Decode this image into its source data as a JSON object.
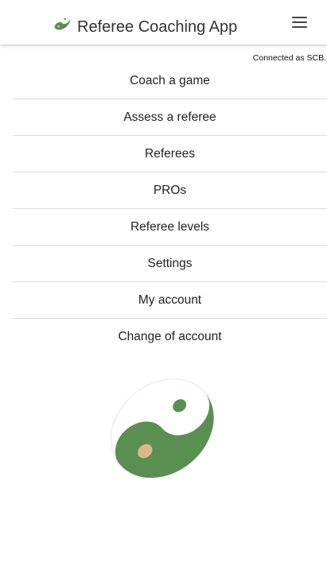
{
  "header": {
    "title": "Referee Coaching App",
    "logo_icon": "yin-yang-logo-icon",
    "menu_icon": "hamburger-menu-icon"
  },
  "status": {
    "connected_text": "Connected as SCB."
  },
  "nav": {
    "items": [
      {
        "label": "Coach a game"
      },
      {
        "label": "Assess a referee"
      },
      {
        "label": "Referees"
      },
      {
        "label": "PROs"
      },
      {
        "label": "Referee levels"
      },
      {
        "label": "Settings"
      },
      {
        "label": "My account"
      },
      {
        "label": "Change of account"
      }
    ]
  },
  "colors": {
    "brand_green": "#5a8f52",
    "accent_tan": "#d9b98a",
    "divider": "#dcdcdc"
  }
}
